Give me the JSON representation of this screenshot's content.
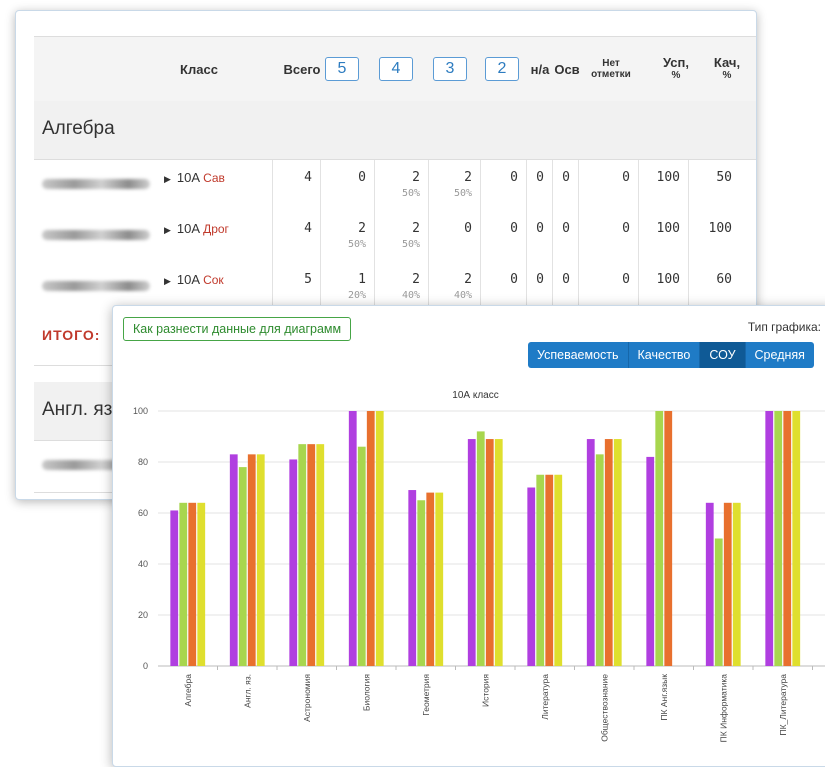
{
  "table": {
    "headers": {
      "klass": "Класс",
      "total": "Всего",
      "g5": "5",
      "g4": "4",
      "g3": "3",
      "g2": "2",
      "na": "н/а",
      "osv": "Осв",
      "no_mark_1": "Нет",
      "no_mark_2": "отметки",
      "usp_1": "Усп,",
      "usp_2": "%",
      "kach_1": "Кач,",
      "kach_2": "%"
    },
    "subjects": [
      {
        "name": "Алгебра",
        "rows": [
          {
            "klass": "10А",
            "teacher": "Сав",
            "total": "4",
            "g5": "0",
            "g5p": "",
            "g4": "2",
            "g4p": "50%",
            "g3": "2",
            "g3p": "50%",
            "g2": "0",
            "na": "0",
            "osv": "0",
            "nomark": "0",
            "usp": "100",
            "kach": "50"
          },
          {
            "klass": "10А",
            "teacher": "Дрог",
            "total": "4",
            "g5": "2",
            "g5p": "50%",
            "g4": "2",
            "g4p": "50%",
            "g3": "0",
            "g3p": "",
            "g2": "0",
            "na": "0",
            "osv": "0",
            "nomark": "0",
            "usp": "100",
            "kach": "100"
          },
          {
            "klass": "10А",
            "teacher": "Сок",
            "total": "5",
            "g5": "1",
            "g5p": "20%",
            "g4": "2",
            "g4p": "40%",
            "g3": "2",
            "g3p": "40%",
            "g2": "0",
            "na": "0",
            "osv": "0",
            "nomark": "0",
            "usp": "100",
            "kach": "60"
          }
        ]
      }
    ],
    "itogo": "ИТОГО:",
    "second_subject": "Англ. яз."
  },
  "chart_panel": {
    "help_link": "Как разнести данные для диаграмм",
    "type_label": "Тип графика:",
    "type_buttons": [
      "Успеваемость",
      "Качество",
      "СОУ",
      "Средняя"
    ],
    "active_type": "СОУ"
  },
  "chart_data": {
    "type": "bar",
    "title": "10А класс",
    "xlabel": "",
    "ylabel": "",
    "ylim": [
      0,
      100
    ],
    "yticks": [
      0,
      20,
      40,
      60,
      80,
      100
    ],
    "grid": true,
    "categories": [
      "Алгебра",
      "Англ. яз.",
      "Астрономия",
      "Биология",
      "Геометрия",
      "История",
      "Литература",
      "Обществознание",
      "ПК Анг.язык",
      "ПК Информатика",
      "ПК_Литература"
    ],
    "series": [
      {
        "color": "#b03fe0",
        "values": [
          61,
          83,
          81,
          100,
          69,
          89,
          70,
          89,
          82,
          64,
          100
        ]
      },
      {
        "color": "#a8d64e",
        "values": [
          64,
          78,
          87,
          86,
          65,
          92,
          75,
          83,
          100,
          50,
          100
        ]
      },
      {
        "color": "#e8702e",
        "values": [
          64,
          83,
          87,
          100,
          68,
          89,
          75,
          89,
          100,
          64,
          100
        ]
      },
      {
        "color": "#dfdf2e",
        "values": [
          64,
          83,
          87,
          100,
          68,
          89,
          75,
          89,
          null,
          64,
          100
        ]
      }
    ]
  }
}
